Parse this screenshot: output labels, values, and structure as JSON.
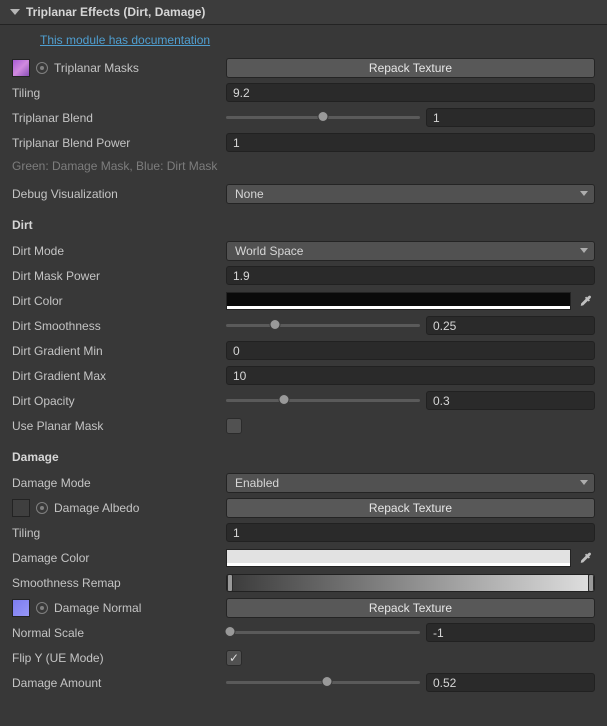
{
  "header": {
    "title": "Triplanar Effects (Dirt, Damage)"
  },
  "doc_link": "This module has documentation",
  "triplanar": {
    "masks_label": "Triplanar Masks",
    "repack_btn": "Repack Texture",
    "tiling_label": "Tiling",
    "tiling_value": "9.2",
    "blend_label": "Triplanar Blend",
    "blend_value": "1",
    "blend_slider_pct": 0.5,
    "blend_power_label": "Triplanar Blend Power",
    "blend_power_value": "1",
    "hint": "Green: Damage Mask, Blue: Dirt Mask"
  },
  "debug": {
    "label": "Debug Visualization",
    "value": "None"
  },
  "dirt": {
    "section": "Dirt",
    "mode_label": "Dirt Mode",
    "mode_value": "World Space",
    "mask_power_label": "Dirt Mask Power",
    "mask_power_value": "1.9",
    "color_label": "Dirt Color",
    "smooth_label": "Dirt Smoothness",
    "smooth_value": "0.25",
    "smooth_slider_pct": 0.25,
    "grad_min_label": "Dirt Gradient Min",
    "grad_min_value": "0",
    "grad_max_label": "Dirt Gradient Max",
    "grad_max_value": "10",
    "opacity_label": "Dirt Opacity",
    "opacity_value": "0.3",
    "opacity_slider_pct": 0.3,
    "planar_label": "Use Planar Mask"
  },
  "damage": {
    "section": "Damage",
    "mode_label": "Damage Mode",
    "mode_value": "Enabled",
    "albedo_label": "Damage Albedo",
    "repack_btn": "Repack Texture",
    "tiling_label": "Tiling",
    "tiling_value": "1",
    "color_label": "Damage Color",
    "remap_label": "Smoothness Remap",
    "normal_label": "Damage Normal",
    "repack_btn2": "Repack Texture",
    "normal_scale_label": "Normal Scale",
    "normal_scale_value": "-1",
    "normal_scale_slider_pct": 0.0,
    "flipy_label": "Flip Y (UE Mode)",
    "flipy_checked": true,
    "amount_label": "Damage Amount",
    "amount_value": "0.52",
    "amount_slider_pct": 0.52
  }
}
